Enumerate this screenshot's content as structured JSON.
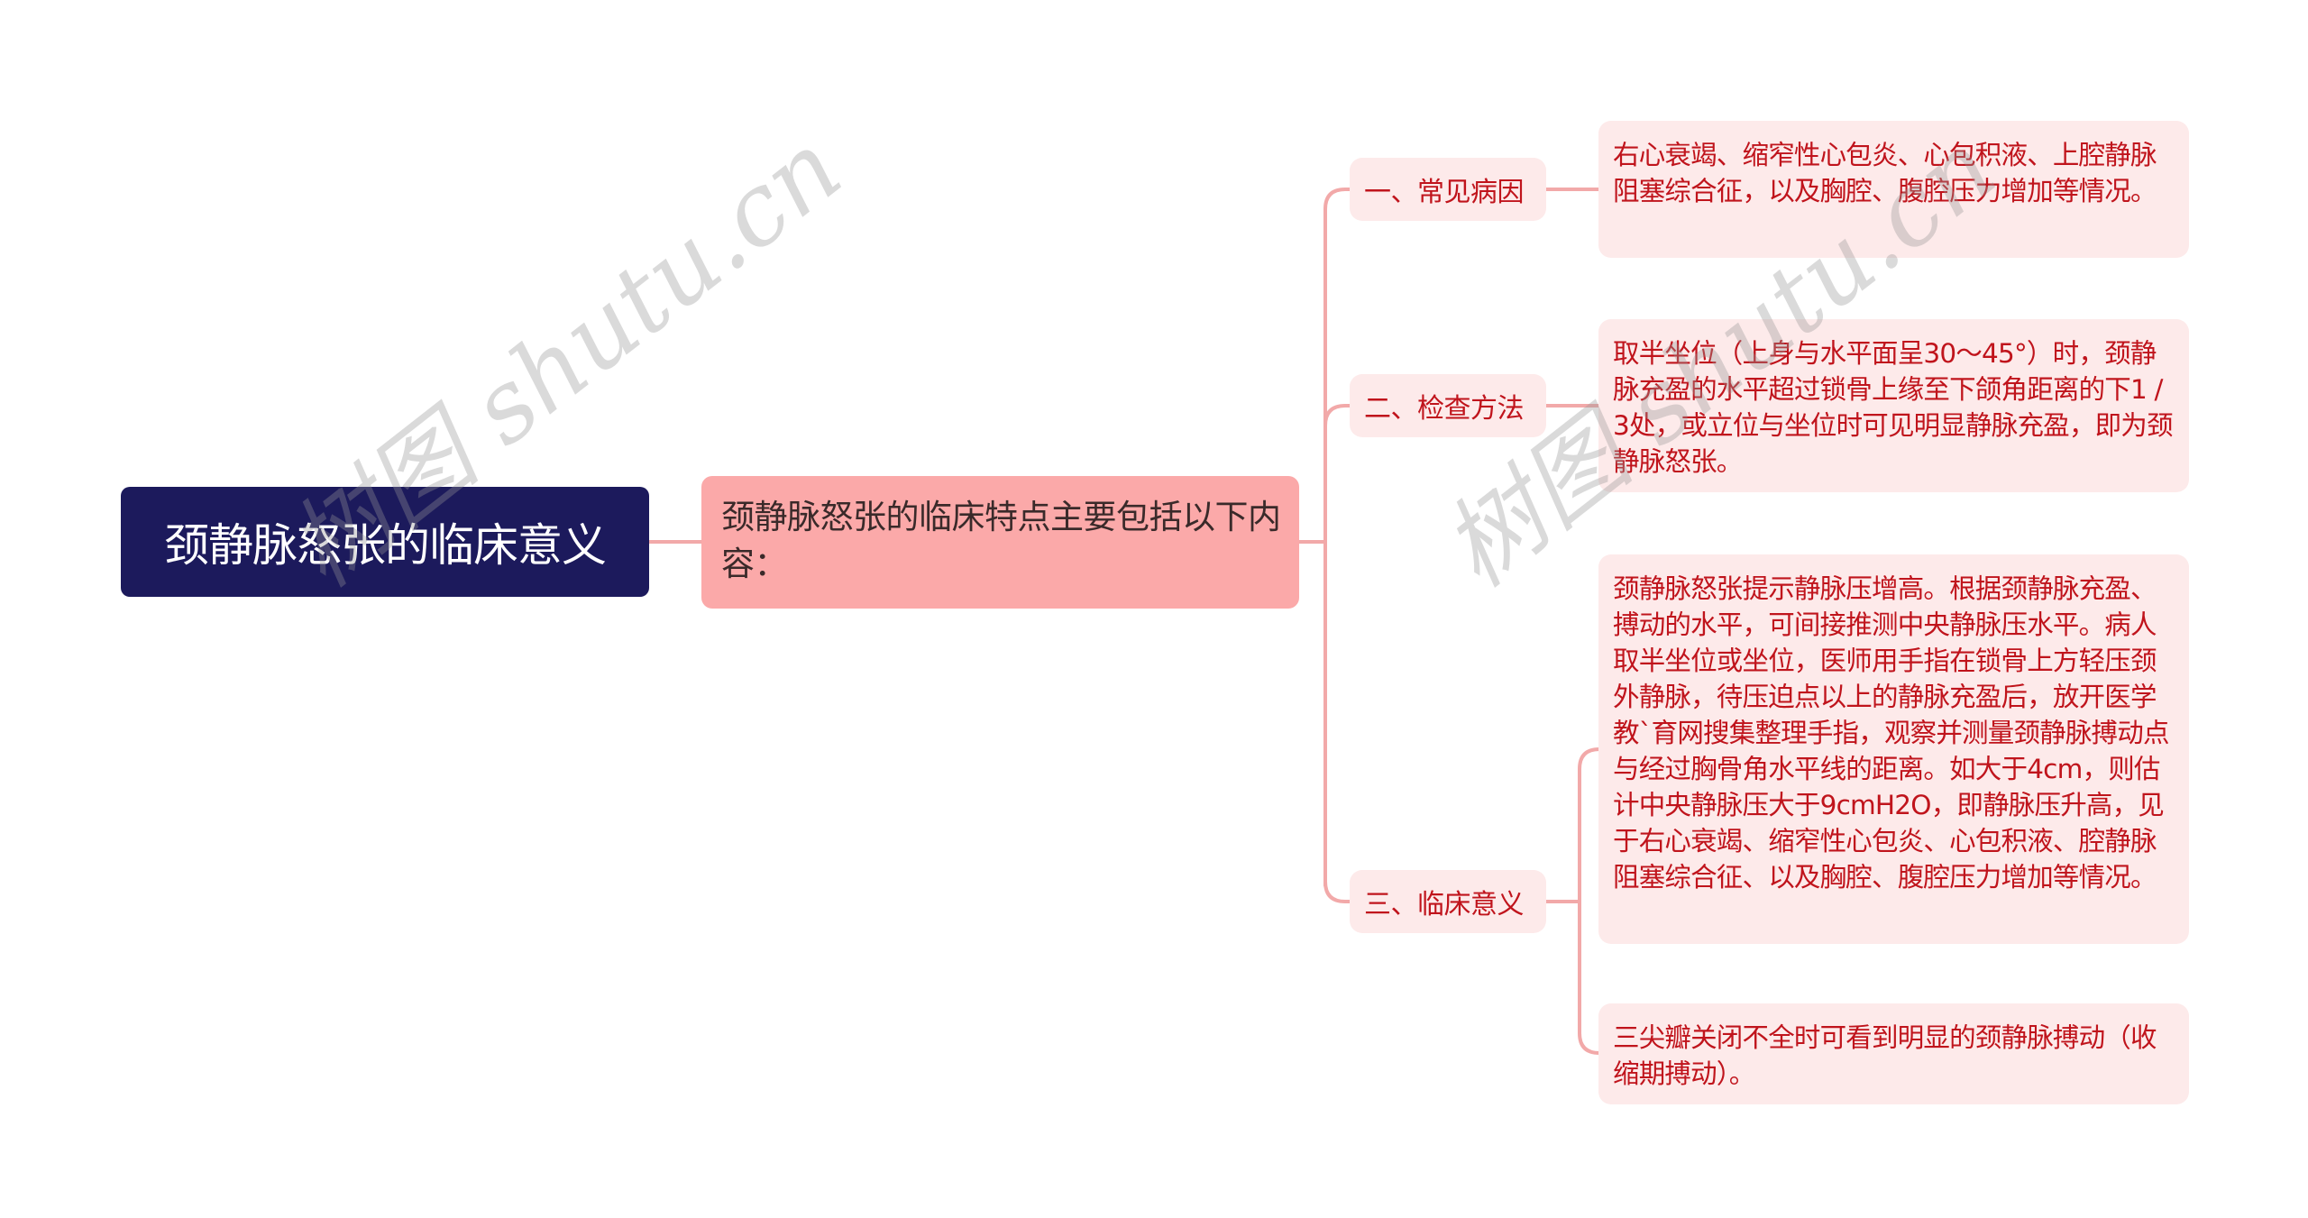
{
  "mindmap": {
    "root": {
      "label": "颈静脉怒张的临床意义"
    },
    "center": {
      "label": "颈静脉怒张的临床特点主要包括以下内容："
    },
    "branches": [
      {
        "label": "一、常见病因",
        "leaves": [
          "右心衰竭、缩窄性心包炎、心包积液、上腔静脉阻塞综合征，以及胸腔、腹腔压力增加等情况。"
        ]
      },
      {
        "label": "二、检查方法",
        "leaves": [
          "取半坐位（上身与水平面呈30～45°）时，颈静脉充盈的水平超过锁骨上缘至下颌角距离的下1 / 3处，或立位与坐位时可见明显静脉充盈，即为颈静脉怒张。"
        ]
      },
      {
        "label": "三、临床意义",
        "leaves": [
          "颈静脉怒张提示静脉压增高。根据颈静脉充盈、搏动的水平，可间接推测中央静脉压水平。病人取半坐位或坐位，医师用手指在锁骨上方轻压颈外静脉，待压迫点以上的静脉充盈后，放开医学教`育网搜集整理手指，观察并测量颈静脉搏动点与经过胸骨角水平线的距离。如大于4cm，则估计中央静脉压大于9cmH2O，即静脉压升高，见于右心衰竭、缩窄性心包炎、心包积液、腔静脉阻塞综合征、以及胸腔、腹腔压力增加等情况。",
          "三尖瓣关闭不全时可看到明显的颈静脉搏动（收缩期搏动）。"
        ]
      }
    ]
  },
  "watermark": {
    "text_1": "树图 shutu.cn",
    "text_2": "树图 shutu.cn"
  },
  "colors": {
    "root_bg": "#1c1a5c",
    "center_bg": "#fba9a9",
    "branch_bg": "#fdeaea",
    "text_red": "#c0141c",
    "connector": "#f2a9a9"
  }
}
